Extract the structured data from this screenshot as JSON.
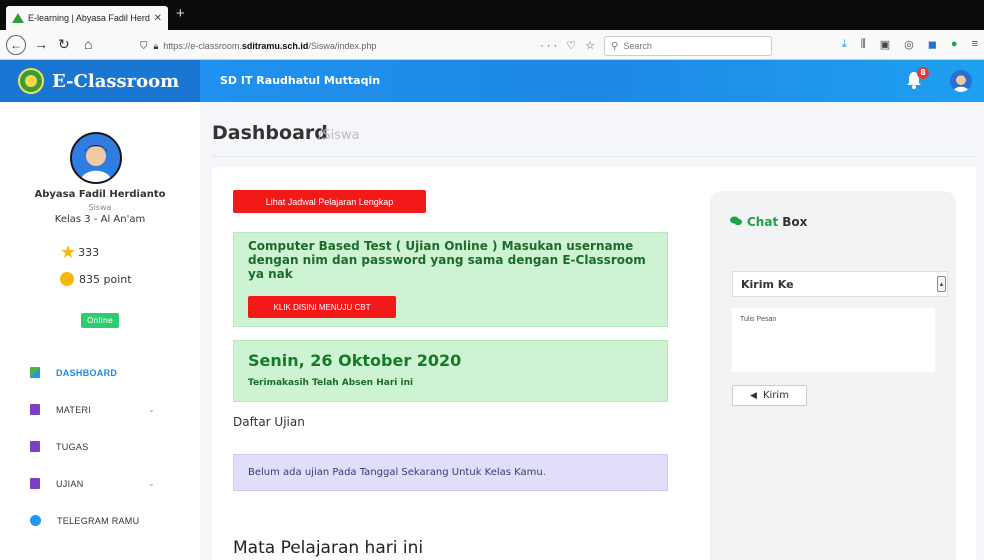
{
  "browser": {
    "tab_title": "E-learning | Abyasa Fadil Herdi",
    "tab_close": "✕",
    "new_tab": "+",
    "url_prefix": "https://e-classroom.",
    "url_domain": "sditramu.sch.id",
    "url_path": "/Siswa/index.php",
    "url_actions": "··· ♡ ☆",
    "search_placeholder": "Search"
  },
  "header": {
    "brand": "E-Classroom",
    "school": "SD IT Raudhatul Muttaqin",
    "notification_count": "8"
  },
  "profile": {
    "name": "Abyasa Fadil Herdianto",
    "role": "Siswa",
    "class": "Kelas 3 - Al An'am",
    "stars": "333",
    "points": "835 point",
    "status": "Online"
  },
  "menu": [
    {
      "label": "DASHBOARD",
      "icon": "dashboard-icon",
      "active": true
    },
    {
      "label": "MATERI",
      "icon": "book-icon",
      "chevron": "⌄"
    },
    {
      "label": "TUGAS",
      "icon": "book-icon"
    },
    {
      "label": "UJIAN",
      "icon": "book-icon",
      "chevron": "⌄"
    },
    {
      "label": "TELEGRAM RAMU",
      "icon": "telegram-icon"
    }
  ],
  "page": {
    "title": "Dashboard",
    "breadcrumb": "/Siswa"
  },
  "main": {
    "schedule_button": "Lihat Jadwal Pelajaran Lengkap",
    "cbt_text": "Computer Based Test ( Ujian Online ) Masukan username dengan nim dan password yang sama dengan E-Classroom ya nak",
    "cbt_button": "KLIK DISINI MENUJU CBT",
    "date": "Senin, 26 Oktober 2020",
    "attendance": "Terimakasih Telah Absen Hari ini",
    "exam_list_title": "Daftar Ujian",
    "exam_info": "Belum ada ujian Pada Tanggal Sekarang Untuk Kelas Kamu.",
    "subjects_title": "Mata Pelajaran hari ini"
  },
  "chat": {
    "title_accent": "Chat",
    "title_rest": "Box",
    "recipient_label": "Kirim Ke",
    "message_placeholder": "Tulis Pesan",
    "send_label": "Kirim"
  },
  "colors": {
    "brand_blue": "#1e88e5",
    "danger_red": "#f31919",
    "success_green": "#cdf3d2",
    "info_purple": "#e1defa",
    "online_green": "#2ecc71"
  }
}
